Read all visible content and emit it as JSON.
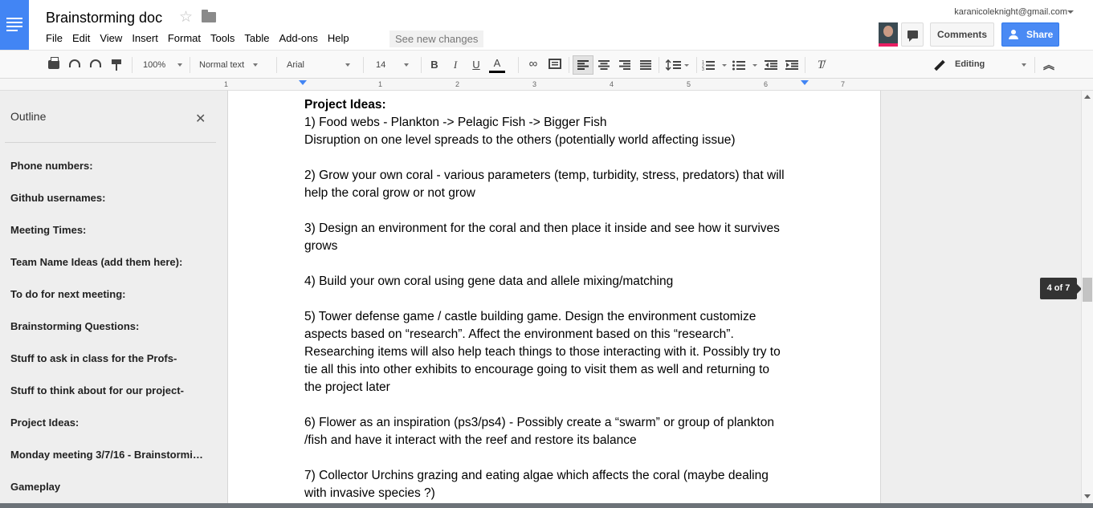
{
  "app": {
    "title": "Brainstorming doc",
    "menu": [
      "File",
      "Edit",
      "View",
      "Insert",
      "Format",
      "Tools",
      "Table",
      "Add-ons",
      "Help"
    ],
    "see_changes": "See new changes",
    "account_email": "karanicoleknight@gmail.com",
    "comments_label": "Comments",
    "share_label": "Share"
  },
  "toolbar": {
    "zoom": "100%",
    "style": "Normal text",
    "font": "Arial",
    "size": "14",
    "bold": "B",
    "italic": "I",
    "underline": "U",
    "text_color": "A",
    "mode": "Editing"
  },
  "ruler": {
    "numbers": [
      "1",
      "1",
      "2",
      "3",
      "4",
      "5",
      "6",
      "7"
    ]
  },
  "outline": {
    "title": "Outline",
    "close": "✕",
    "items": [
      "Phone numbers:",
      "Github usernames:",
      "Meeting Times:",
      "Team Name Ideas (add them here):",
      "To do for next meeting:",
      "Brainstorming Questions:",
      "Stuff to ask in class for the Profs-",
      "Stuff to think about for our project-",
      "Project Ideas:",
      "Monday meeting 3/7/16 - Brainstormi…",
      "Gameplay"
    ]
  },
  "document": {
    "heading": "Project Ideas:",
    "lines": [
      "1) Food webs - Plankton -> Pelagic Fish -> Bigger Fish",
      "Disruption on one level spreads to the others (potentially world affecting issue)",
      "",
      "2) Grow your own coral - various parameters (temp, turbidity, stress, predators) that will",
      "help the coral grow or not grow",
      "",
      "3) Design an environment for the coral and then place it inside and see how it survives",
      "grows",
      "",
      "4) Build your own coral using gene data and allele mixing/matching",
      "",
      "5) Tower defense game / castle building game. Design the environment customize",
      "aspects based on “research”. Affect the environment based on this “research”.",
      "Researching items will also help teach things to those interacting with it. Possibly try to",
      "tie all this into other exhibits to encourage going to visit them as well and returning to",
      "the project later",
      "",
      "6) Flower as an inspiration (ps3/ps4) - Possibly create a “swarm” or group of plankton",
      "/fish and have it interact with the reef and restore its balance",
      "",
      "7) Collector Urchins grazing and eating algae which affects the coral (maybe dealing",
      "with invasive species ?)"
    ]
  },
  "page_indicator": "4 of 7"
}
